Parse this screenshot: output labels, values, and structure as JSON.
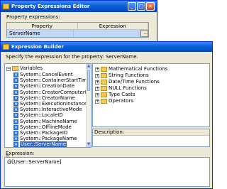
{
  "back_window": {
    "title": "Property Expressions Editor",
    "prompt": "Property expressions:",
    "columns": [
      "Property",
      "Expression"
    ],
    "row": {
      "property": "ServerName",
      "expression": ""
    },
    "ellipsis": "..."
  },
  "front_window": {
    "title": "Expression Builder",
    "prompt": "Specify the expression for the property: ServerName.",
    "variables_root": "Variables",
    "variables": [
      "System::CancelEvent",
      "System::ContainerStartTime",
      "System::CreationDate",
      "System::CreatorComputerName",
      "System::CreatorName",
      "System::ExecutionInstanceGUID",
      "System::InteractiveMode",
      "System::LocaleID",
      "System::MachineName",
      "System::OfflineMode",
      "System::PackageID",
      "System::PackageName",
      "User::ServerName"
    ],
    "selected_variable": "User::ServerName",
    "functions": [
      "Mathematical Functions",
      "String Functions",
      "Date/Time Functions",
      "NULL Functions",
      "Type Casts",
      "Operators"
    ],
    "description_label": "Description:",
    "expression_label_first": "E",
    "expression_label_rest": "xpression:",
    "expression_value": "@[User::ServerName]"
  },
  "window_buttons": {
    "minimize": "_",
    "maximize": "□",
    "close": "✕"
  },
  "colors": {
    "titlebar": "#0a5fd8",
    "selection": "#316ac5",
    "window_bg": "#ece9d8"
  }
}
